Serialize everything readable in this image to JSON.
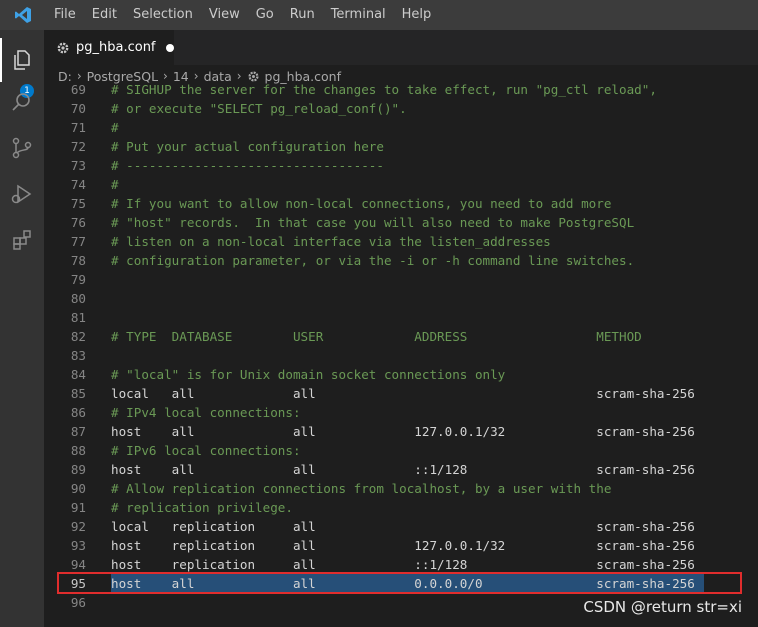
{
  "menu": [
    "File",
    "Edit",
    "Selection",
    "View",
    "Go",
    "Run",
    "Terminal",
    "Help"
  ],
  "tab": {
    "label": "pg_hba.conf"
  },
  "activity": {
    "badge": "1"
  },
  "breadcrumb": [
    "D:",
    "PostgreSQL",
    "14",
    "data",
    "pg_hba.conf"
  ],
  "editor": {
    "lines": [
      {
        "n": "69",
        "t": "# SIGHUP the server for the changes to take effect, run \"pg_ctl reload\",",
        "c": true
      },
      {
        "n": "70",
        "t": "# or execute \"SELECT pg_reload_conf()\".",
        "c": true
      },
      {
        "n": "71",
        "t": "#",
        "c": true
      },
      {
        "n": "72",
        "t": "# Put your actual configuration here",
        "c": true
      },
      {
        "n": "73",
        "t": "# ----------------------------------",
        "c": true
      },
      {
        "n": "74",
        "t": "#",
        "c": true
      },
      {
        "n": "75",
        "t": "# If you want to allow non-local connections, you need to add more",
        "c": true
      },
      {
        "n": "76",
        "t": "# \"host\" records.  In that case you will also need to make PostgreSQL",
        "c": true
      },
      {
        "n": "77",
        "t": "# listen on a non-local interface via the listen_addresses",
        "c": true
      },
      {
        "n": "78",
        "t": "# configuration parameter, or via the -i or -h command line switches.",
        "c": true
      },
      {
        "n": "79",
        "t": "",
        "c": false
      },
      {
        "n": "80",
        "t": "",
        "c": false
      },
      {
        "n": "81",
        "t": "",
        "c": false
      },
      {
        "n": "82",
        "t": "# TYPE  DATABASE        USER            ADDRESS                 METHOD",
        "c": true
      },
      {
        "n": "83",
        "t": "",
        "c": false
      },
      {
        "n": "84",
        "t": "# \"local\" is for Unix domain socket connections only",
        "c": true
      },
      {
        "n": "85",
        "t": "local   all             all                                     scram-sha-256",
        "c": false
      },
      {
        "n": "86",
        "t": "# IPv4 local connections:",
        "c": true
      },
      {
        "n": "87",
        "t": "host    all             all             127.0.0.1/32            scram-sha-256",
        "c": false
      },
      {
        "n": "88",
        "t": "# IPv6 local connections:",
        "c": true
      },
      {
        "n": "89",
        "t": "host    all             all             ::1/128                 scram-sha-256",
        "c": false
      },
      {
        "n": "90",
        "t": "# Allow replication connections from localhost, by a user with the",
        "c": true
      },
      {
        "n": "91",
        "t": "# replication privilege.",
        "c": true
      },
      {
        "n": "92",
        "t": "local   replication     all                                     scram-sha-256",
        "c": false
      },
      {
        "n": "93",
        "t": "host    replication     all             127.0.0.1/32            scram-sha-256",
        "c": false
      },
      {
        "n": "94",
        "t": "host    replication     all             ::1/128                 scram-sha-256",
        "c": false
      },
      {
        "n": "95",
        "t": "host    all             all             0.0.0.0/0               scram-sha-256",
        "c": false,
        "selected": true
      },
      {
        "n": "96",
        "t": "",
        "c": false
      }
    ]
  },
  "watermark": "CSDN @return str=xi",
  "colors": {
    "comment": "#6a9955",
    "selection": "#264f78",
    "highlight_box": "#e02d2d"
  }
}
